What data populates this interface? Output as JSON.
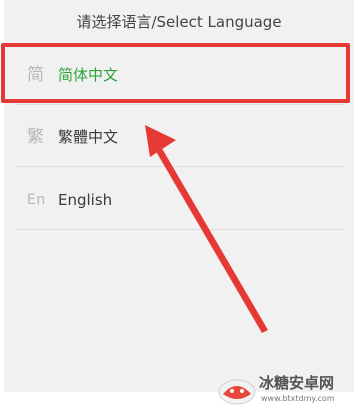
{
  "dialog": {
    "title": "请选择语言/Select Language"
  },
  "languages": [
    {
      "glyph": "简",
      "label": "简体中文",
      "selected": true
    },
    {
      "glyph": "繁",
      "label": "繁體中文",
      "selected": false
    },
    {
      "glyph": "En",
      "label": "English",
      "selected": false
    }
  ],
  "colors": {
    "selected_text": "#2ea33c",
    "annotation": "#e53935"
  },
  "watermark": {
    "name": "冰糖安卓网",
    "url": "www.btxtdmy.com"
  }
}
